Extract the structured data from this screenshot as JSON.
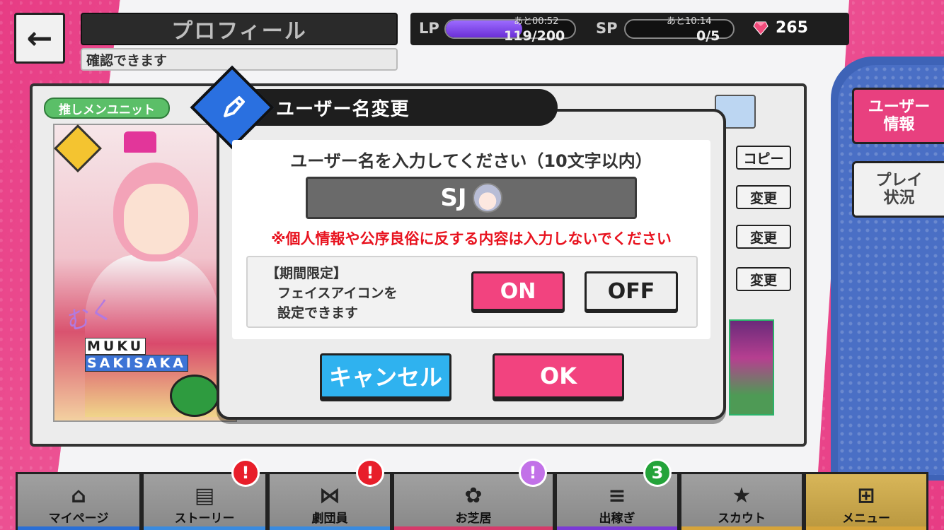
{
  "header": {
    "back_glyph": "←",
    "title": "プロフィール",
    "subtitle": "確認できます"
  },
  "status": {
    "lp_label": "LP",
    "lp_timer": "あと00:52",
    "lp_value": "119/200",
    "lp_fill": 0.595,
    "sp_label": "SP",
    "sp_timer": "あと10:14",
    "sp_value": "0/5",
    "sp_fill": 0.0,
    "gem_count": "265"
  },
  "side_tabs": [
    {
      "label": "ユーザー\n情報",
      "active": true
    },
    {
      "label": "プレイ\n状況",
      "active": false
    }
  ],
  "profile": {
    "unit_tag": "推しメンユニット",
    "card_name_line1": "MUKU",
    "card_name_line2": "SAKISAKA",
    "card_signature": "むく",
    "row_buttons": [
      "コピー",
      "変更",
      "変更",
      "変更"
    ]
  },
  "modal": {
    "title": "ユーザー名変更",
    "prompt": "ユーザー名を入力してください（10文字以内）",
    "username": "SJ",
    "warning": "※個人情報や公序良俗に反する内容は入力しないでください",
    "option_title": "【期間限定】",
    "option_line1": "フェイスアイコンを",
    "option_line2": "設定できます",
    "on_label": "ON",
    "off_label": "OFF",
    "cancel_label": "キャンセル",
    "ok_label": "OK"
  },
  "bottom_nav": [
    {
      "label": "マイページ",
      "icon": "home-icon",
      "glyph": "⌂",
      "bar": "#2a6fd6"
    },
    {
      "label": "ストーリー",
      "icon": "book-icon",
      "glyph": "▤",
      "bar": "#3a8be0",
      "alert": "!",
      "alert_color": "red"
    },
    {
      "label": "劇団員",
      "icon": "bowtie-icon",
      "glyph": "⋈",
      "bar": "#3a8be0",
      "alert": "!",
      "alert_color": "red"
    },
    {
      "label": "お芝居",
      "icon": "stage-icon",
      "glyph": "✿",
      "bar": "#d63a6a",
      "alert": "!",
      "alert_color": "purple"
    },
    {
      "label": "出稼ぎ",
      "icon": "coins-icon",
      "glyph": "≡",
      "bar": "#7b3ad6",
      "alert": "3",
      "alert_color": "green"
    },
    {
      "label": "スカウト",
      "icon": "star-badge-icon",
      "glyph": "★",
      "bar": "#d6a43a"
    },
    {
      "label": "メニュー",
      "icon": "grid-menu-icon",
      "glyph": "⊞",
      "bar": "#d6a43a",
      "active": true
    }
  ],
  "colors": {
    "accent_pink": "#f2437f",
    "accent_blue": "#2fb2ef",
    "warning_red": "#e8131f"
  }
}
